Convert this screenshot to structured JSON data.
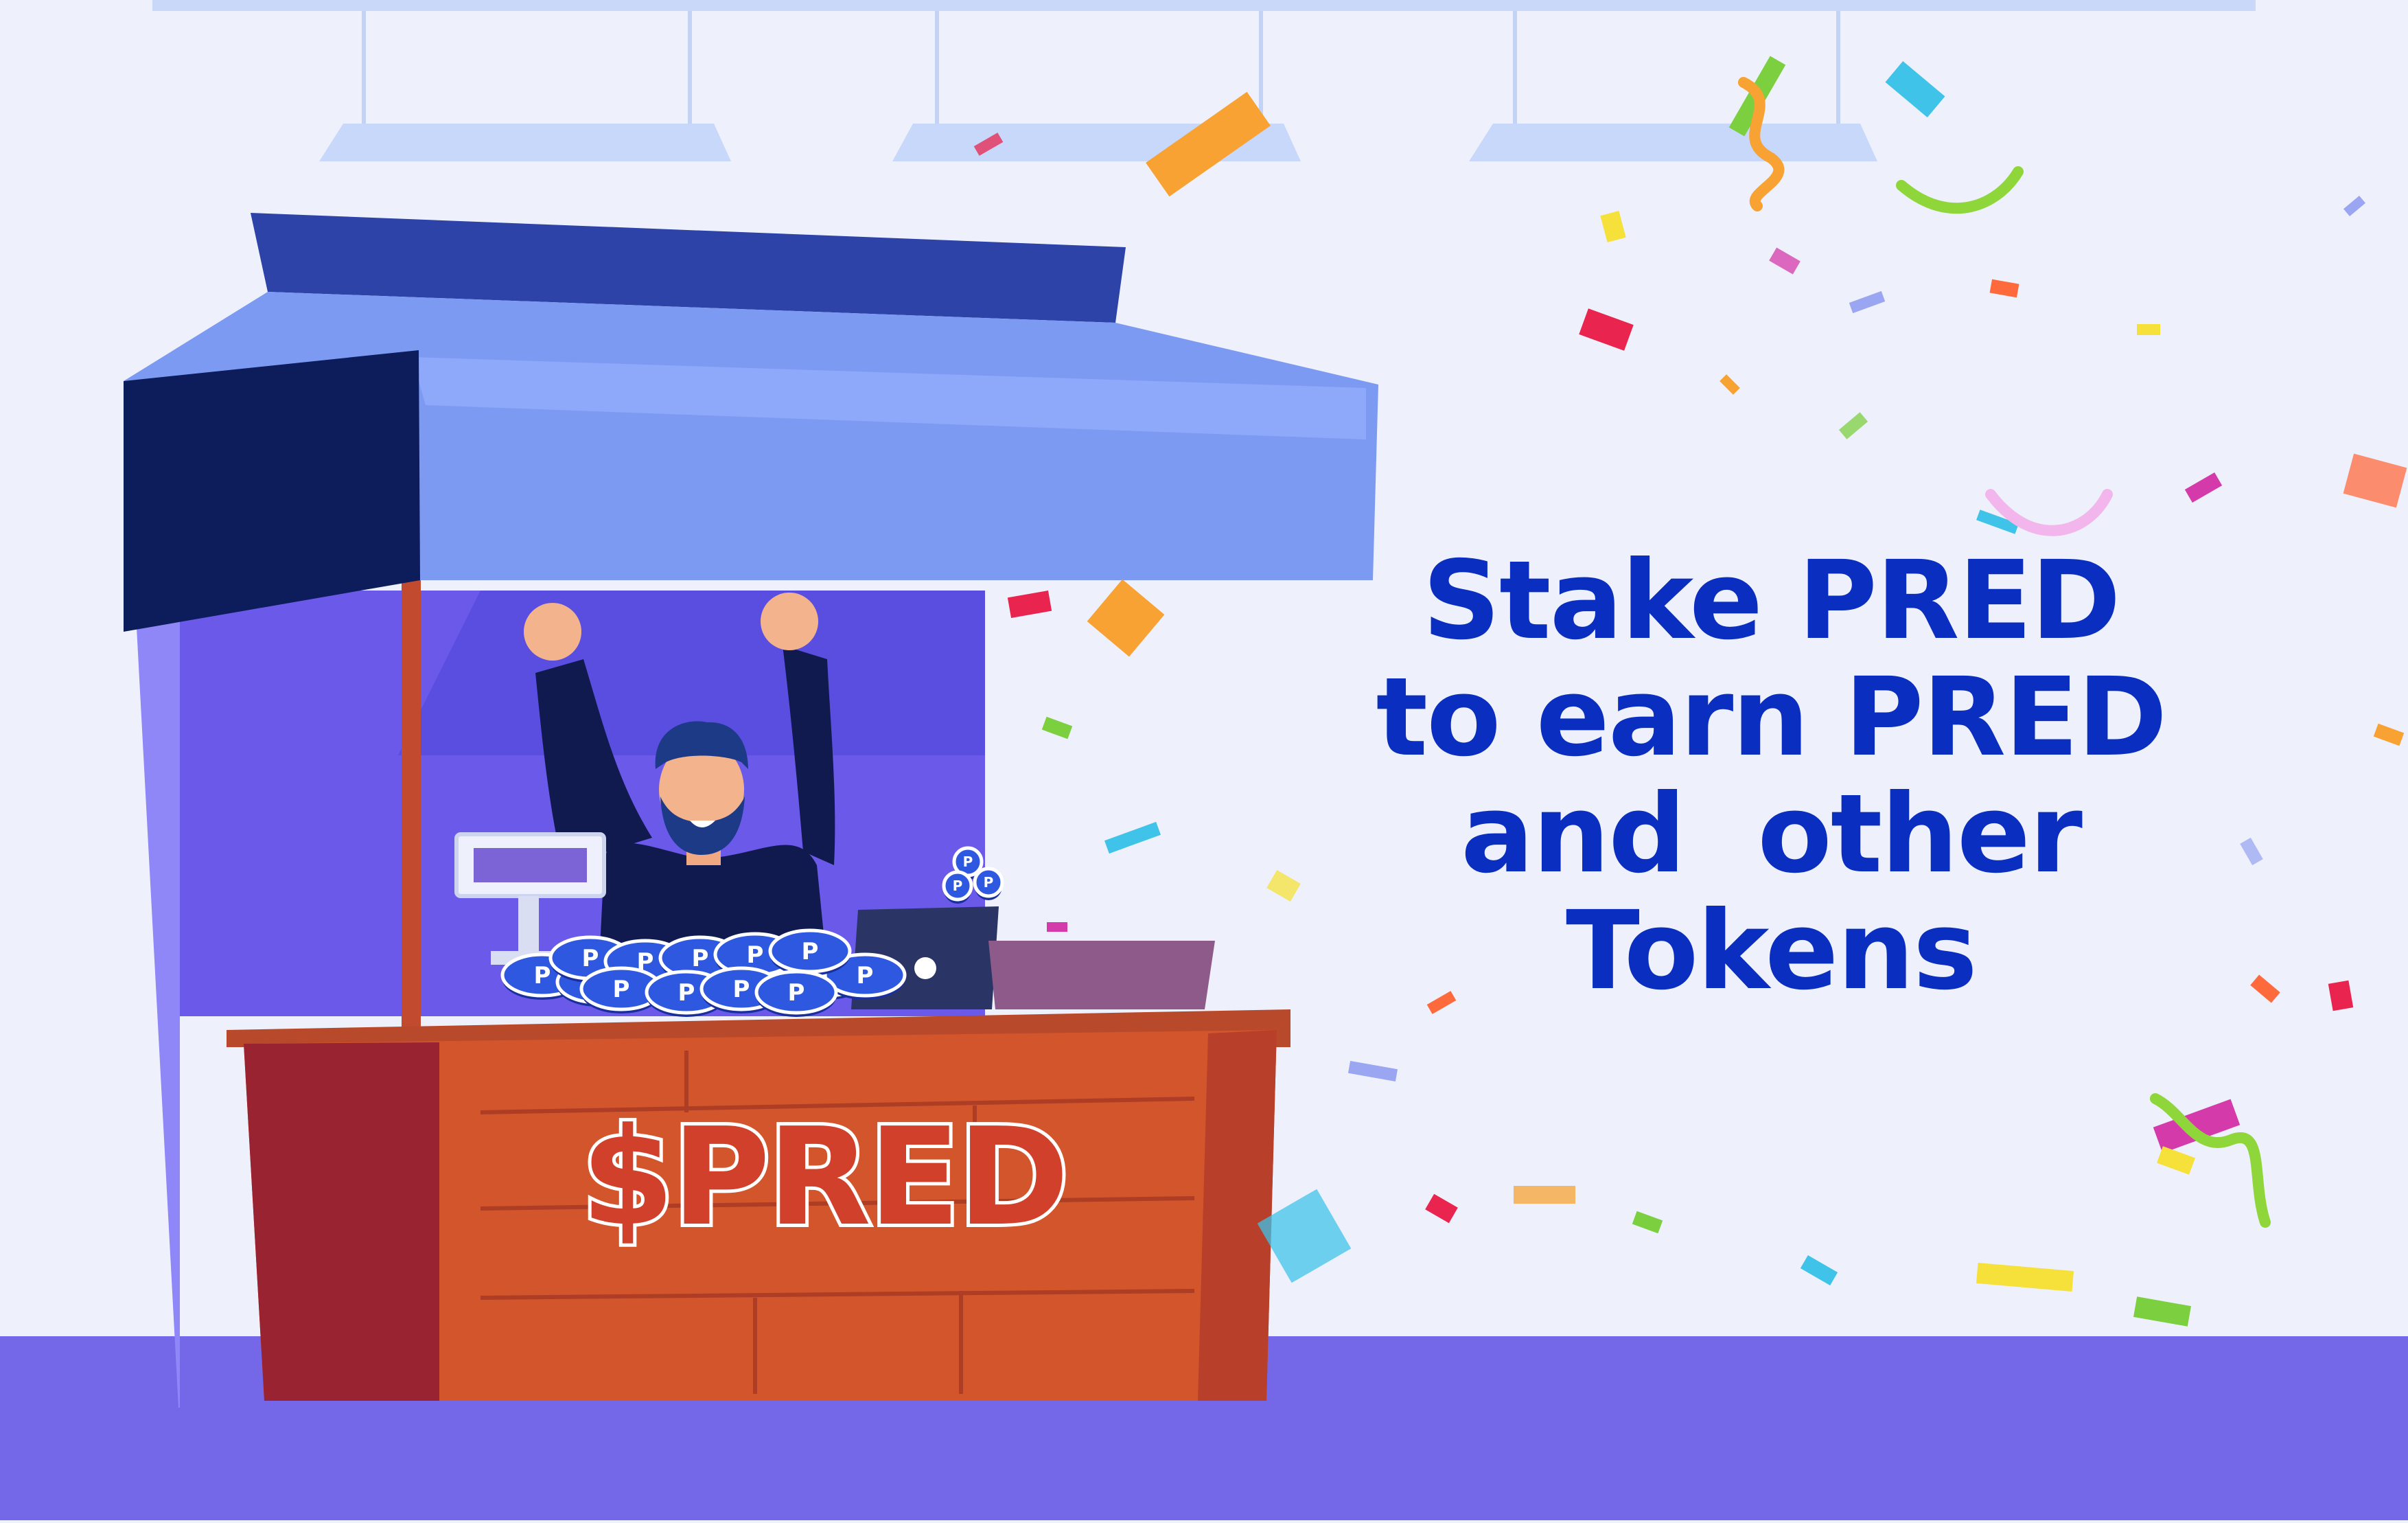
{
  "headline": {
    "lines": [
      "Stake PRED",
      "to earn PRED",
      "and  other",
      "Tokens"
    ]
  },
  "stall_sign": "$PRED",
  "coin_letter": "P",
  "colors": {
    "headline": "#0a2fc0",
    "background": "#eef1fb",
    "floor": "#7468e8",
    "awning": "#7d9af2",
    "awning_dark": "#0d1c5a",
    "counter": "#d2552c",
    "sign_fill": "#d0402a",
    "sign_outline": "#ffffff"
  },
  "icons": [
    "confetti",
    "coin-icon",
    "cash-register",
    "laptop",
    "shopkeeper",
    "ceiling-lamp"
  ]
}
